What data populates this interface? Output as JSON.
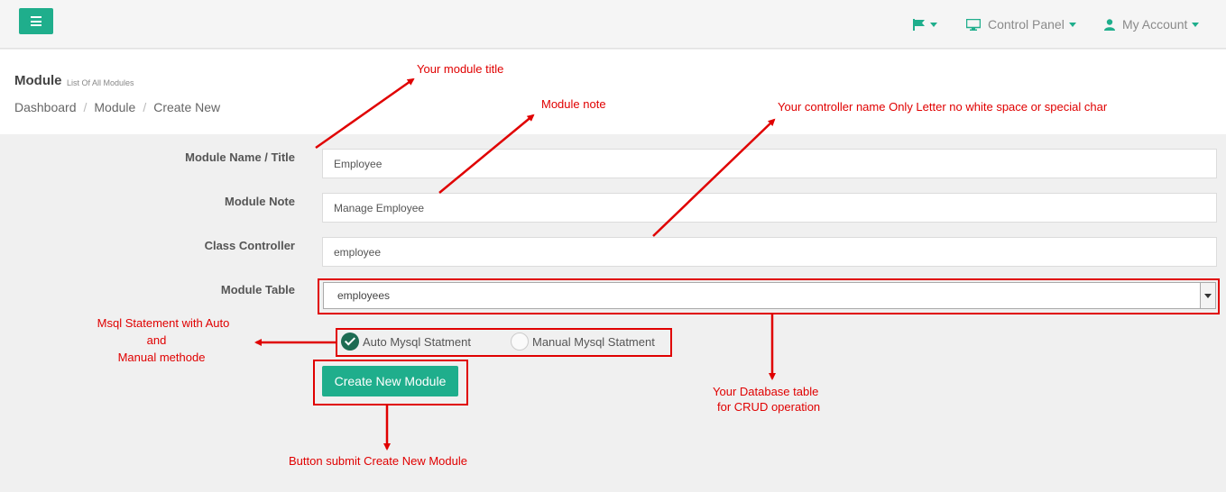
{
  "topbar": {
    "menu_icon": "bars-icon",
    "flag_icon": "flag-icon",
    "control_panel_label": "Control Panel",
    "control_panel_icon": "monitor-icon",
    "account_label": "My Account",
    "account_icon": "user-icon",
    "accent_color": "#1fae8c"
  },
  "header": {
    "title": "Module",
    "subtitle": "List Of All Modules",
    "breadcrumb": [
      "Dashboard",
      "Module",
      "Create New"
    ],
    "breadcrumb_separator": "/"
  },
  "form": {
    "module_name": {
      "label": "Module Name / Title",
      "value": "Employee"
    },
    "module_note": {
      "label": "Module Note",
      "value": "Manage Employee"
    },
    "class_controller": {
      "label": "Class Controller",
      "value": "employee"
    },
    "module_table": {
      "label": "Module Table",
      "value": "employees"
    },
    "radio_auto": {
      "label": "Auto Mysql Statment",
      "checked": true
    },
    "radio_manual": {
      "label": "Manual Mysql Statment",
      "checked": false
    },
    "submit_label": "Create New Module"
  },
  "annotations": {
    "color": "#e00000",
    "module_title": "Your module title",
    "module_note": "Module note",
    "controller_name": "Your controller name  Only Letter no white space or special char",
    "msql_line1": "Msql Statement with Auto",
    "msql_line2": "and",
    "msql_line3": "Manual methode",
    "db_table_line1": "Your Database table",
    "db_table_line2": "for CRUD operation",
    "button_submit": "Button submit Create New Module"
  }
}
